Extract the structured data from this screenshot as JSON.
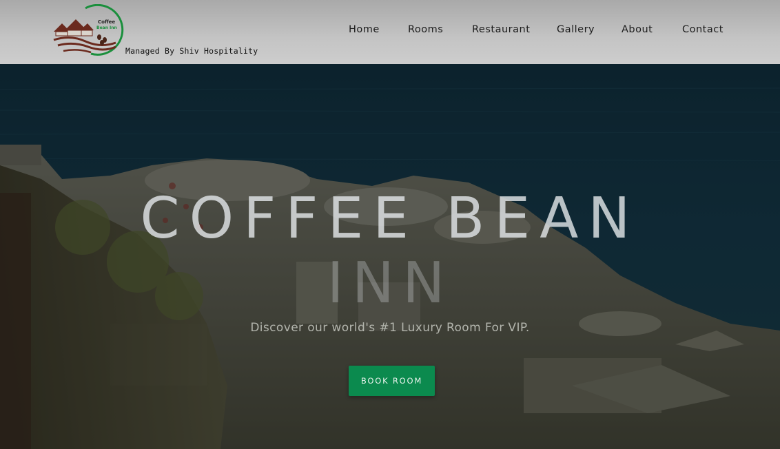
{
  "header": {
    "logo": {
      "text_line1": "Coffee",
      "text_line2": "Bean Inn",
      "tagline": "Managed By Shiv Hospitality"
    },
    "nav": [
      {
        "label": "Home"
      },
      {
        "label": "Rooms"
      },
      {
        "label": "Restaurant"
      },
      {
        "label": "Gallery"
      },
      {
        "label": "About"
      },
      {
        "label": "Contact"
      }
    ]
  },
  "hero": {
    "title_line1": "COFFEE BEAN",
    "title_line2": "INN",
    "subtitle": "Discover our world's #1 Luxury Room For VIP.",
    "cta_label": "BOOK ROOM"
  },
  "colors": {
    "accent": "#0b8a4e",
    "logo_ring": "#1a8f3c",
    "logo_brown": "#6b2a1e"
  }
}
